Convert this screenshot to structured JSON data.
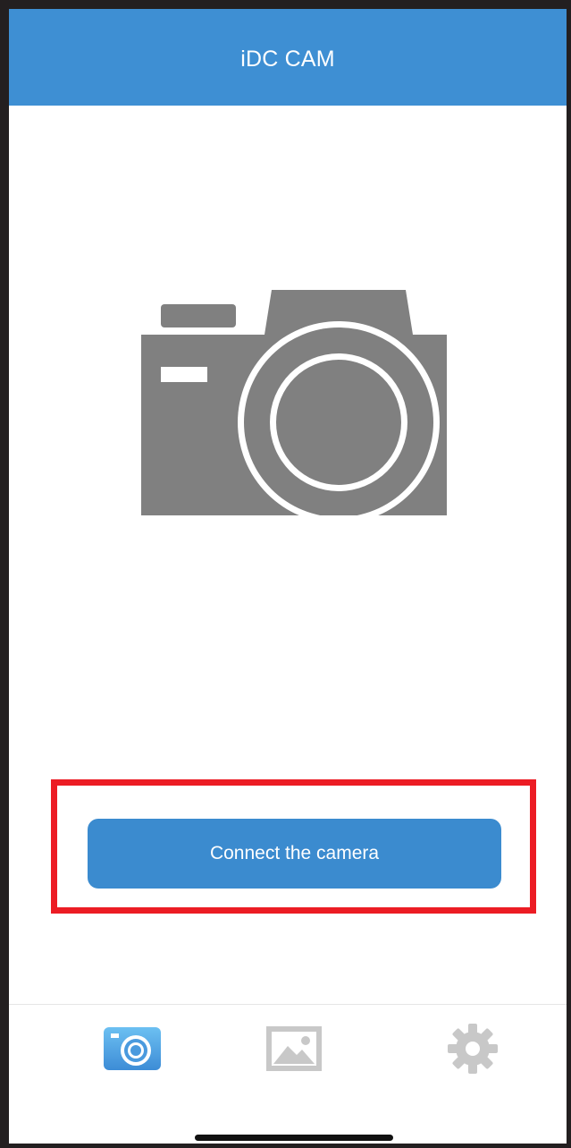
{
  "app": {
    "title": "iDC CAM"
  },
  "main": {
    "hero_icon": "camera-icon",
    "connect_button_label": "Connect the camera"
  },
  "tab_bar": {
    "items": [
      {
        "icon": "camera-tab-icon",
        "active": true
      },
      {
        "icon": "gallery-icon",
        "active": false
      },
      {
        "icon": "gear-icon",
        "active": false
      }
    ]
  },
  "colors": {
    "nav_bar": "#3e8fd3",
    "button": "#3b8bcf",
    "highlight_box": "#ec1c24",
    "hero_icon": "#808080",
    "inactive_tab_icon": "#c8c8c8"
  }
}
